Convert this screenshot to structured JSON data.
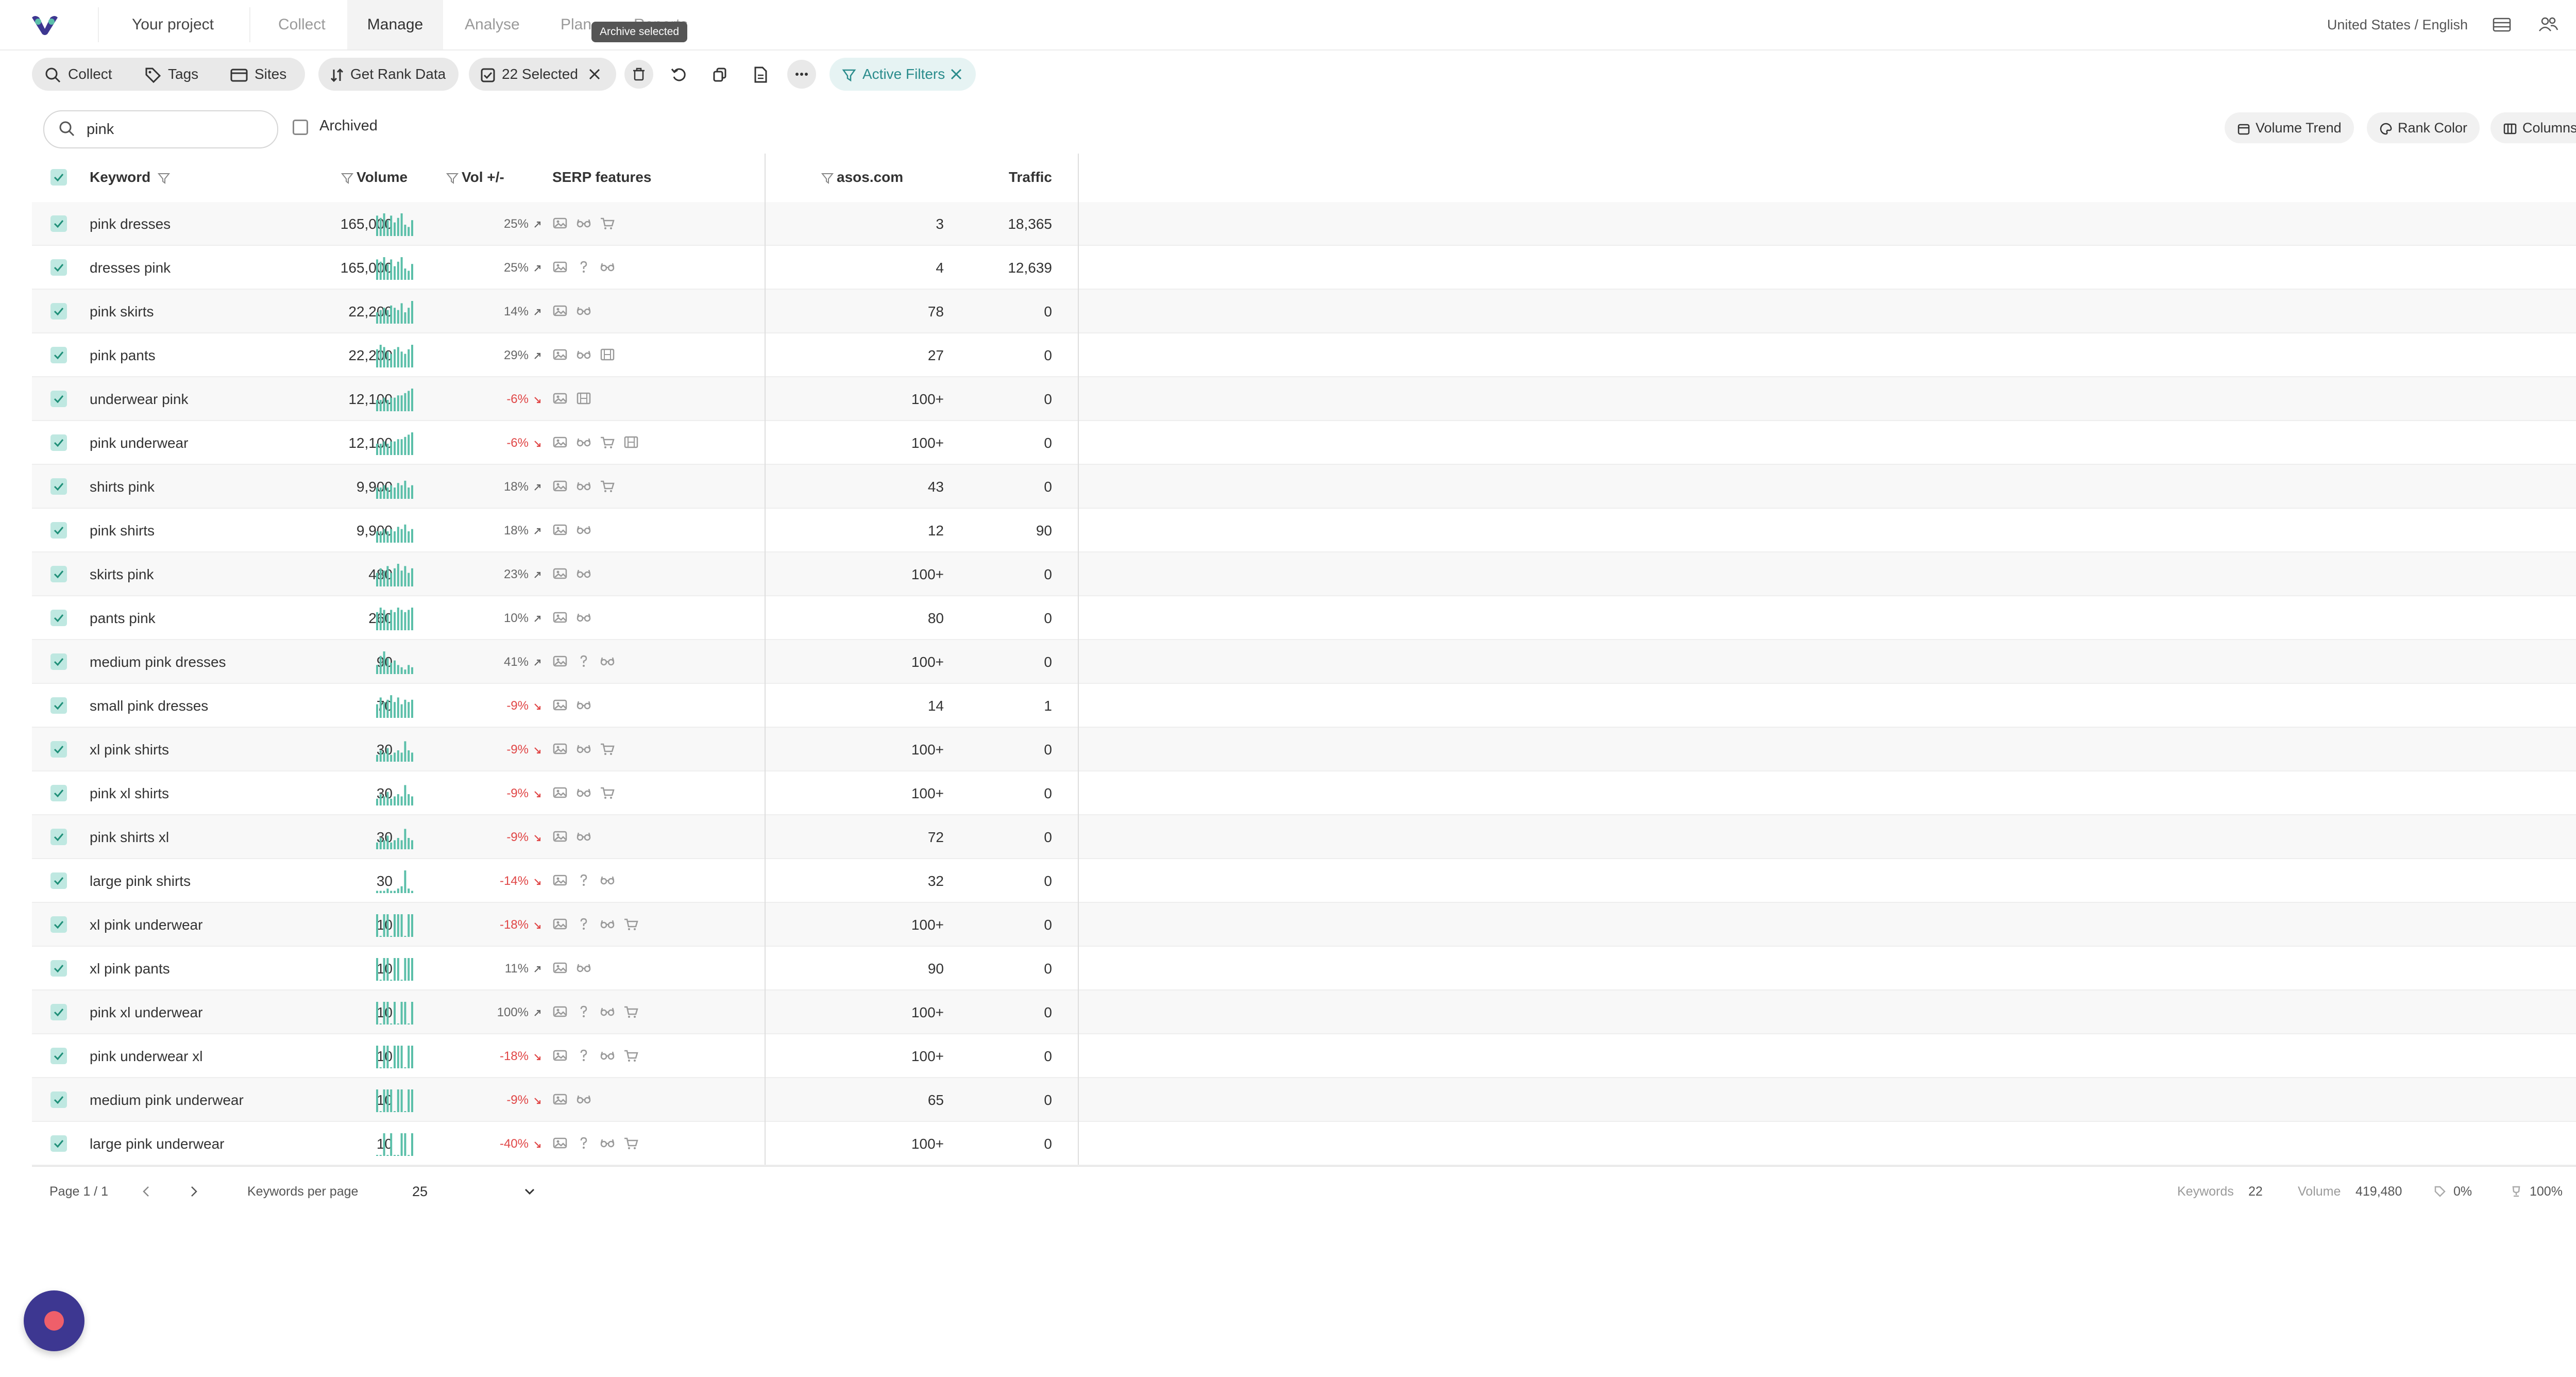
{
  "nav": {
    "project": "Your project",
    "tabs": [
      "Collect",
      "Manage",
      "Analyse",
      "Plan",
      "Reports"
    ],
    "locale": "United States / English"
  },
  "tooltip": "Archive selected",
  "toolbar": {
    "collect": "Collect",
    "tags": "Tags",
    "sites": "Sites",
    "get_rank_data": "Get Rank Data",
    "selected": "22 Selected",
    "active_filters": "Active Filters"
  },
  "search": {
    "value": "pink",
    "archived_label": "Archived"
  },
  "view_buttons": {
    "volume_trend": "Volume Trend",
    "rank_color": "Rank Color",
    "columns": "Columns"
  },
  "columns": {
    "keyword": "Keyword",
    "volume": "Volume",
    "vol_change": "Vol +/-",
    "serp": "SERP features",
    "site": "asos.com",
    "traffic": "Traffic"
  },
  "rows": [
    {
      "keyword": "pink dresses",
      "volume": "165,000",
      "change": "25%",
      "trend": "up",
      "serp": [
        "img",
        "glasses",
        "cart"
      ],
      "rank": "3",
      "traffic": "18,365",
      "spark": [
        9,
        8,
        10,
        7,
        9,
        6,
        8,
        10,
        5,
        4,
        7
      ]
    },
    {
      "keyword": "dresses pink",
      "volume": "165,000",
      "change": "25%",
      "trend": "up",
      "serp": [
        "img",
        "question",
        "glasses"
      ],
      "rank": "4",
      "traffic": "12,639",
      "spark": [
        9,
        8,
        10,
        7,
        9,
        6,
        8,
        10,
        5,
        4,
        7
      ]
    },
    {
      "keyword": "pink skirts",
      "volume": "22,200",
      "change": "14%",
      "trend": "up",
      "serp": [
        "img",
        "glasses"
      ],
      "rank": "78",
      "traffic": "0",
      "spark": [
        5,
        6,
        7,
        6,
        8,
        7,
        6,
        9,
        5,
        7,
        10
      ]
    },
    {
      "keyword": "pink pants",
      "volume": "22,200",
      "change": "29%",
      "trend": "up",
      "serp": [
        "img",
        "glasses",
        "film"
      ],
      "rank": "27",
      "traffic": "0",
      "spark": [
        8,
        10,
        9,
        7,
        6,
        8,
        9,
        7,
        6,
        8,
        10
      ]
    },
    {
      "keyword": "underwear pink",
      "volume": "12,100",
      "change": "-6%",
      "trend": "down",
      "serp": [
        "img",
        "film"
      ],
      "rank": "100+",
      "traffic": "0",
      "spark": [
        5,
        5,
        6,
        5,
        6,
        6,
        7,
        7,
        8,
        9,
        10
      ]
    },
    {
      "keyword": "pink underwear",
      "volume": "12,100",
      "change": "-6%",
      "trend": "down",
      "serp": [
        "img",
        "glasses",
        "cart",
        "film"
      ],
      "rank": "100+",
      "traffic": "0",
      "spark": [
        5,
        5,
        6,
        5,
        6,
        6,
        7,
        7,
        8,
        9,
        10
      ]
    },
    {
      "keyword": "shirts pink",
      "volume": "9,900",
      "change": "18%",
      "trend": "up",
      "serp": [
        "img",
        "glasses",
        "cart"
      ],
      "rank": "43",
      "traffic": "0",
      "spark": [
        5,
        5,
        6,
        5,
        6,
        5,
        7,
        6,
        8,
        5,
        6
      ]
    },
    {
      "keyword": "pink shirts",
      "volume": "9,900",
      "change": "18%",
      "trend": "up",
      "serp": [
        "img",
        "glasses"
      ],
      "rank": "12",
      "traffic": "90",
      "spark": [
        5,
        5,
        6,
        5,
        6,
        5,
        7,
        6,
        8,
        5,
        6
      ]
    },
    {
      "keyword": "skirts pink",
      "volume": "480",
      "change": "23%",
      "trend": "up",
      "serp": [
        "img",
        "glasses"
      ],
      "rank": "100+",
      "traffic": "0",
      "spark": [
        6,
        8,
        7,
        9,
        6,
        8,
        10,
        7,
        9,
        6,
        8
      ]
    },
    {
      "keyword": "pants pink",
      "volume": "260",
      "change": "10%",
      "trend": "up",
      "serp": [
        "img",
        "glasses"
      ],
      "rank": "80",
      "traffic": "0",
      "spark": [
        8,
        10,
        9,
        7,
        9,
        8,
        10,
        9,
        8,
        9,
        10
      ]
    },
    {
      "keyword": "medium pink dresses",
      "volume": "90",
      "change": "41%",
      "trend": "up",
      "serp": [
        "img",
        "question",
        "glasses"
      ],
      "rank": "100+",
      "traffic": "0",
      "spark": [
        4,
        8,
        10,
        7,
        5,
        6,
        4,
        3,
        2,
        4,
        3
      ]
    },
    {
      "keyword": "small pink dresses",
      "volume": "70",
      "change": "-9%",
      "trend": "down",
      "serp": [
        "img",
        "glasses"
      ],
      "rank": "14",
      "traffic": "1",
      "spark": [
        6,
        9,
        7,
        8,
        10,
        7,
        9,
        6,
        8,
        7,
        8
      ]
    },
    {
      "keyword": "xl pink shirts",
      "volume": "30",
      "change": "-9%",
      "trend": "down",
      "serp": [
        "img",
        "glasses",
        "cart"
      ],
      "rank": "100+",
      "traffic": "0",
      "spark": [
        3,
        5,
        4,
        6,
        3,
        4,
        5,
        4,
        9,
        5,
        4
      ]
    },
    {
      "keyword": "pink xl shirts",
      "volume": "30",
      "change": "-9%",
      "trend": "down",
      "serp": [
        "img",
        "glasses",
        "cart"
      ],
      "rank": "100+",
      "traffic": "0",
      "spark": [
        3,
        5,
        4,
        6,
        3,
        4,
        5,
        4,
        9,
        5,
        4
      ]
    },
    {
      "keyword": "pink shirts xl",
      "volume": "30",
      "change": "-9%",
      "trend": "down",
      "serp": [
        "img",
        "glasses"
      ],
      "rank": "72",
      "traffic": "0",
      "spark": [
        3,
        5,
        4,
        6,
        3,
        4,
        5,
        4,
        9,
        5,
        4
      ]
    },
    {
      "keyword": "large pink shirts",
      "volume": "30",
      "change": "-14%",
      "trend": "down",
      "serp": [
        "img",
        "question",
        "glasses"
      ],
      "rank": "32",
      "traffic": "0",
      "spark": [
        1,
        1,
        1,
        2,
        1,
        1,
        2,
        3,
        10,
        2,
        1
      ]
    },
    {
      "keyword": "xl pink underwear",
      "volume": "10",
      "change": "-18%",
      "trend": "down",
      "serp": [
        "img",
        "question",
        "glasses",
        "cart"
      ],
      "rank": "100+",
      "traffic": "0",
      "spark": [
        10,
        0,
        10,
        10,
        0,
        10,
        10,
        10,
        0,
        10,
        10
      ]
    },
    {
      "keyword": "xl pink pants",
      "volume": "10",
      "change": "11%",
      "trend": "up",
      "serp": [
        "img",
        "glasses"
      ],
      "rank": "90",
      "traffic": "0",
      "spark": [
        10,
        0,
        10,
        10,
        0,
        10,
        10,
        0,
        10,
        10,
        10
      ]
    },
    {
      "keyword": "pink xl underwear",
      "volume": "10",
      "change": "100%",
      "trend": "up",
      "serp": [
        "img",
        "question",
        "glasses",
        "cart"
      ],
      "rank": "100+",
      "traffic": "0",
      "spark": [
        10,
        0,
        10,
        10,
        0,
        10,
        0,
        10,
        10,
        0,
        10
      ]
    },
    {
      "keyword": "pink underwear xl",
      "volume": "10",
      "change": "-18%",
      "trend": "down",
      "serp": [
        "img",
        "question",
        "glasses",
        "cart"
      ],
      "rank": "100+",
      "traffic": "0",
      "spark": [
        10,
        0,
        10,
        10,
        0,
        10,
        10,
        10,
        0,
        10,
        10
      ]
    },
    {
      "keyword": "medium pink underwear",
      "volume": "10",
      "change": "-9%",
      "trend": "down",
      "serp": [
        "img",
        "glasses"
      ],
      "rank": "65",
      "traffic": "0",
      "spark": [
        10,
        0,
        10,
        10,
        10,
        0,
        10,
        10,
        0,
        10,
        10
      ]
    },
    {
      "keyword": "large pink underwear",
      "volume": "10",
      "change": "-40%",
      "trend": "down",
      "serp": [
        "img",
        "question",
        "glasses",
        "cart"
      ],
      "rank": "100+",
      "traffic": "0",
      "spark": [
        0,
        0,
        10,
        0,
        10,
        0,
        0,
        10,
        10,
        0,
        10
      ]
    }
  ],
  "footer": {
    "page": "Page 1 / 1",
    "per_page_label": "Keywords per page",
    "per_page_value": "25",
    "keywords_label": "Keywords",
    "keywords_value": "22",
    "volume_label": "Volume",
    "volume_value": "419,480",
    "share1": "0%",
    "share2": "100%"
  },
  "colors": {
    "accent": "#5bbfa9",
    "negative": "#e04646",
    "fab": "#3d3791",
    "fab_dot": "#ef5f6a"
  }
}
